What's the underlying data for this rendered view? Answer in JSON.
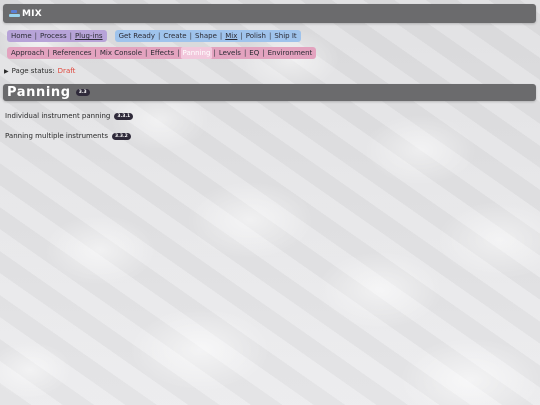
{
  "header": {
    "title": "MIX",
    "logo_icon": "mix-logo-icon"
  },
  "nav": {
    "group1": [
      "Home",
      "Process",
      "Plug-ins"
    ],
    "group2": [
      "Get Ready",
      "Create",
      "Shape",
      "Mix",
      "Polish",
      "Ship It"
    ],
    "group3": [
      "Approach",
      "References",
      "Mix Console",
      "Effects",
      "Panning",
      "Levels",
      "EQ",
      "Environment"
    ]
  },
  "status": {
    "label": "Page status:",
    "value": "Draft"
  },
  "section": {
    "title": "Panning",
    "badge": "3.3"
  },
  "topics": [
    {
      "label": "Individual instrument panning",
      "badge": "3.3.1"
    },
    {
      "label": "Panning multiple instruments",
      "badge": "3.3.2"
    }
  ],
  "colors": {
    "header_bg": "#6b6b6d",
    "nav_purple": "#b7a3d8",
    "nav_blue": "#9fc3ec",
    "nav_pink": "#e3a3bf",
    "status_draft": "#e0453a",
    "badge_bg": "#2f2a3a"
  }
}
